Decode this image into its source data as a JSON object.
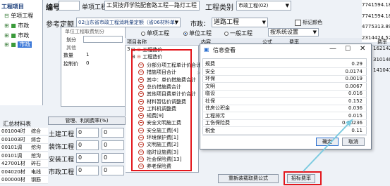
{
  "tree": {
    "title": "工程项目",
    "items": [
      {
        "label": "单项工程",
        "selected": false
      },
      {
        "label": "市政",
        "selected": false
      },
      {
        "label": "市政",
        "selected": false
      },
      {
        "label": "市政",
        "selected": true
      }
    ]
  },
  "header": {
    "code_label": "编号",
    "single_project_label": "单项工程",
    "single_project_value": "工贸技师学院配套路工程—路灯工程",
    "project_type_label": "工程类别",
    "project_type_value": "市政工程(02)"
  },
  "reference": {
    "label": "参考定额",
    "value": "02山东省市政工程消耗量定额（省06材料单）",
    "municipal_label": "市政：",
    "municipal_value": "道路工程",
    "mark_color_label": "标记颜色"
  },
  "mode": {
    "options": [
      {
        "label": "单项工程",
        "selected": false
      },
      {
        "label": "单位工程",
        "selected": true
      },
      {
        "label": "一般工程",
        "selected": false
      }
    ],
    "settings_label": "按系统设置"
  },
  "props": {
    "section_title": "单位工程取费划分",
    "divide_label": "划分",
    "other_label": "其他",
    "qty_label": "数量",
    "qty_value": "1",
    "control_price_label": "控制价",
    "control_price_value": "0"
  },
  "fee_tree": {
    "columns": [
      "项目名称",
      "内容",
      "公式",
      "费率"
    ],
    "root_label": "工程造价",
    "root_code": "3",
    "items": [
      "分部分项工程单计价合计",
      "措施项目合计",
      "其中：单价措施费合计",
      "总价措施费合计",
      "其他项目费单计价合计",
      "材料暂估价调整费",
      "工料机调整费",
      "规费[9]",
      "安全文明施工费",
      "安全施工费[4]",
      "环境保护费[1]",
      "文明施工费[2]",
      "临时设施费[3]",
      "社会保险费[13]",
      "养老保险费"
    ]
  },
  "dialog": {
    "title": "信息查看",
    "rows": [
      {
        "name": "规费",
        "value": "0.29"
      },
      {
        "name": "安全",
        "value": "0.0174"
      },
      {
        "name": "环保",
        "value": "0.0019"
      },
      {
        "name": "文明",
        "value": "0.0067"
      },
      {
        "name": "临设",
        "value": "0.016"
      },
      {
        "name": "社保",
        "value": "0.152"
      },
      {
        "name": "住房公积金",
        "value": "0.036"
      },
      {
        "name": "工程排污",
        "value": "0.015"
      },
      {
        "name": "工伤保险费",
        "value": "0.00236"
      },
      {
        "name": "税金",
        "value": "0.11"
      }
    ],
    "ok_label": "确定",
    "cancel_label": "取消"
  },
  "buttons": {
    "recalc_label": "重新装载取费公式",
    "rate_label": "招标费率"
  },
  "bottom_table": {
    "tab_label": "汇总材料表",
    "rows": [
      {
        "code": "001004时",
        "name": "综合"
      },
      {
        "code": "001003时",
        "name": "综合"
      },
      {
        "code": "00101调",
        "name": "挖沟"
      },
      {
        "code": "00101调",
        "name": "挖沟"
      },
      {
        "code": "427001材",
        "name": "碎石"
      },
      {
        "code": "004020材",
        "name": "电线"
      },
      {
        "code": "000000材",
        "name": "钢筋"
      }
    ]
  },
  "mgmt": {
    "title": "管理、利润费率(%)",
    "rows": [
      {
        "label": "土建工程",
        "v1": "0",
        "v2": "0"
      },
      {
        "label": "装饰工程",
        "v1": "0",
        "v2": "0"
      },
      {
        "label": "安装工程",
        "v1": "0",
        "v2": "0"
      },
      {
        "label": "市政工程",
        "v1": "0",
        "v2": "0"
      }
    ]
  },
  "right_values": [
    "7741594.18",
    "7741594.18",
    "4775313.89",
    "2314424.52",
    "1621424.07",
    "3101404",
    "141041.4"
  ],
  "right_value_label": "费率"
}
